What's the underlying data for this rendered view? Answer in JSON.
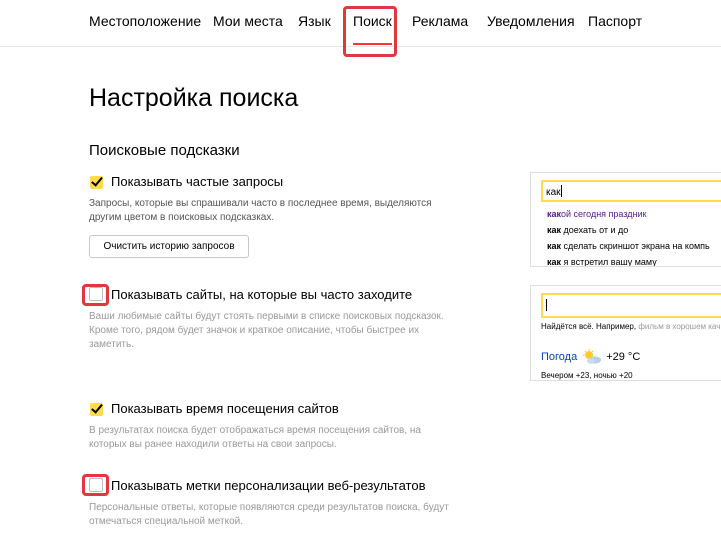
{
  "tabs": [
    {
      "label": "Местоположение"
    },
    {
      "label": "Мои места"
    },
    {
      "label": "Язык"
    },
    {
      "label": "Поиск",
      "active": true
    },
    {
      "label": "Реклама"
    },
    {
      "label": "Уведомления"
    },
    {
      "label": "Паспорт"
    }
  ],
  "page_title": "Настройка поиска",
  "section_title": "Поисковые подсказки",
  "options": [
    {
      "label": "Показывать частые запросы",
      "checked": true,
      "description": "Запросы, которые вы спрашивали часто в последнее время, выделяются другим цветом в поисковых подсказках."
    },
    {
      "label": "Показывать сайты, на которые вы часто заходите",
      "checked": false,
      "description": "Ваши любимые сайты будут стоять первыми в списке поисковых подсказок. Кроме того, рядом будет значок и краткое описание, чтобы быстрее их заметить."
    },
    {
      "label": "Показывать время посещения сайтов",
      "checked": true,
      "description": "В результатах поиска будет отображаться время посещения сайтов, на которых вы ранее находили ответы на свои запросы."
    },
    {
      "label": "Показывать метки персонализации веб-результатов",
      "checked": false,
      "description": "Персональные ответы, которые появляются среди результатов поиска, будут отмечаться специальной меткой."
    }
  ],
  "clear_history_button": "Очистить историю запросов",
  "preview_suggest": {
    "query": "как",
    "suggestions": [
      {
        "bold": "как",
        "rest": "ой сегодня праздник"
      },
      {
        "bold": "как",
        "rest": " доехать от и до"
      },
      {
        "bold": "как",
        "rest": " сделать скриншот экрана на компь"
      },
      {
        "bold": "как",
        "rest": " я встретил вашу маму"
      }
    ]
  },
  "preview_sites": {
    "hint_text": "Найдётся всё. Например,",
    "hint_example": "фильм в хорошем кач",
    "weather_link": "Погода",
    "weather_temp": "+29 °С",
    "weather_sub": "Вечером +23,  ночью +20"
  },
  "colors": {
    "accent": "#ffdb4d",
    "active_tab_underline": "#ff3333",
    "highlight_box": "#e0383e",
    "link": "#0044bb"
  }
}
